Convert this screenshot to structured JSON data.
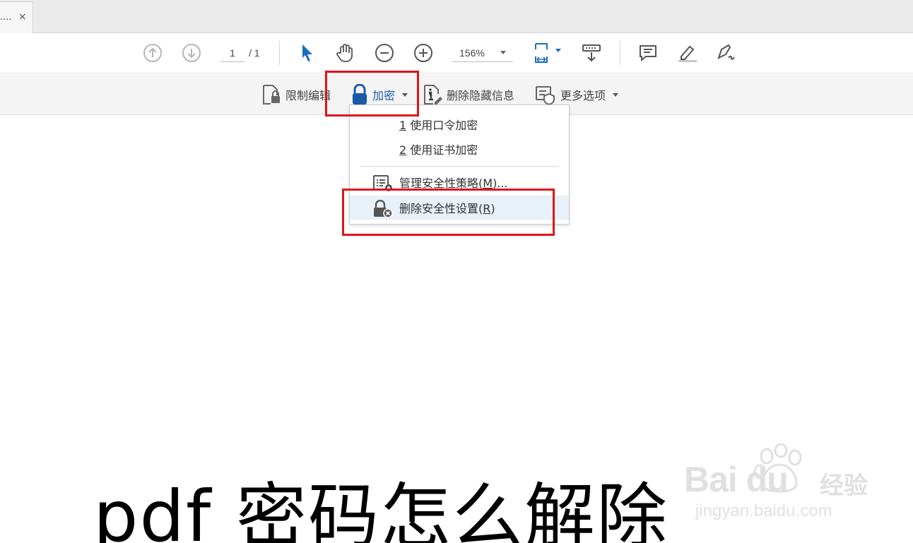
{
  "tab": {
    "title": "....",
    "close": "×"
  },
  "toolbar": {
    "page_current": "1",
    "page_total": "/ 1",
    "zoom": "156%"
  },
  "protect_bar": {
    "restrict_edit": "限制编辑",
    "encrypt": "加密",
    "remove_hidden": "删除隐藏信息",
    "more_options": "更多选项"
  },
  "encrypt_menu": {
    "items": [
      {
        "key": "1",
        "label": " 使用口令加密"
      },
      {
        "key": "2",
        "label": " 使用证书加密"
      },
      {
        "label_pre": "管理安全性策略(",
        "key": "M",
        "label_post": ")..."
      },
      {
        "label_pre": "删除安全性设置(",
        "key": "R",
        "label_post": ")"
      }
    ]
  },
  "caption": "pdf 密码怎么解除",
  "watermark": {
    "brand": "Bai du",
    "brand_cn": "经验",
    "url": "jingyan.baidu.com"
  },
  "colors": {
    "highlight_red": "#e0141c",
    "accent_blue": "#1a5da8",
    "lock_blue": "#1b5aa8"
  }
}
